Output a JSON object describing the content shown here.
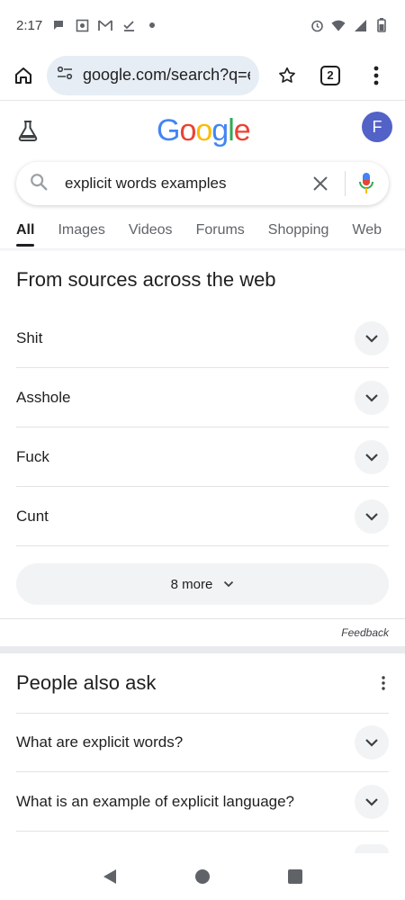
{
  "status_bar": {
    "time": "2:17",
    "left_icons": [
      "chat-bubble-icon",
      "screenshot-icon",
      "gmail-icon",
      "checkmark-download-icon",
      "dot-icon"
    ],
    "right_icons": [
      "alarm-icon",
      "wifi-icon",
      "signal-icon",
      "battery-icon"
    ]
  },
  "browser": {
    "url": "google.com/search?q=e",
    "tab_count": "2"
  },
  "google": {
    "avatar_letter": "F",
    "logo_letters": [
      "G",
      "o",
      "o",
      "g",
      "l",
      "e"
    ],
    "logo_colors": [
      "#4285F4",
      "#EA4335",
      "#FBBC05",
      "#4285F4",
      "#34A853",
      "#EA4335"
    ]
  },
  "search": {
    "query": "explicit words examples"
  },
  "tabs": [
    "All",
    "Images",
    "Videos",
    "Forums",
    "Shopping",
    "Web"
  ],
  "sources_section": {
    "title": "From sources across the web",
    "items": [
      "Shit",
      "Asshole",
      "Fuck",
      "Cunt"
    ],
    "more_label": "8 more",
    "feedback_label": "Feedback"
  },
  "paa_section": {
    "title": "People also ask",
    "questions": [
      "What are explicit words?",
      "What is an example of explicit language?"
    ]
  },
  "colors": {
    "accent_blue": "#4285F4",
    "avatar_bg": "#5262c7",
    "url_pill_bg": "#e6edf5",
    "chip_bg": "#f1f3f4"
  }
}
